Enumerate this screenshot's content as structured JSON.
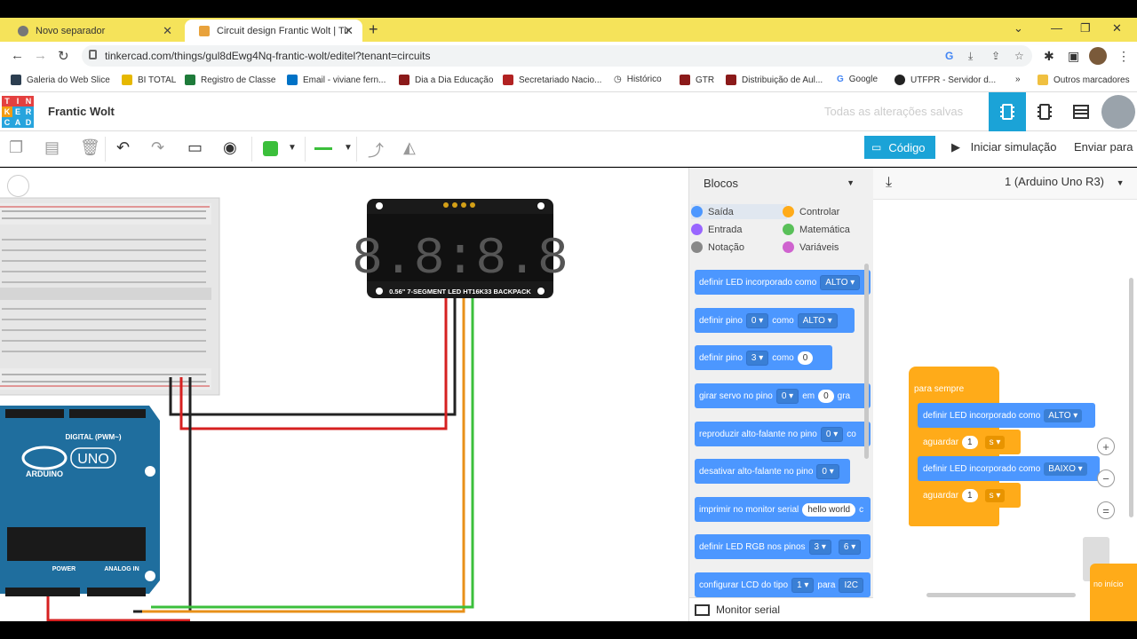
{
  "browser": {
    "tabs": [
      {
        "title": "Novo separador"
      },
      {
        "title": "Circuit design Frantic Wolt | Tinke"
      }
    ],
    "url": "tinkercad.com/things/gul8dEwg4Nq-frantic-wolt/editel?tenant=circuits",
    "bookmarks": [
      "Galeria do Web Slice",
      "BI TOTAL",
      "Registro de Classe",
      "Email - viviane fern...",
      "Dia a Dia Educação",
      "Secretariado Nacio...",
      "Histórico",
      "GTR",
      "Distribuição de Aul...",
      "Google",
      "UTFPR - Servidor d...",
      "»",
      "Outros marcadores"
    ]
  },
  "app": {
    "logo_letters": [
      "T",
      "I",
      "N",
      "K",
      "E",
      "R",
      "C",
      "A",
      "D"
    ],
    "project_name": "Frantic Wolt",
    "saved_status": "Todas as alterações salvas",
    "code_button": "Código",
    "start_sim": "Iniciar simulação",
    "send_to": "Enviar para"
  },
  "canvas": {
    "display_label": "0.56\" 7-SEGMENT LED HT16K33 BACKPACK",
    "display_digits": "8.8:8.8",
    "arduino_digital": "DIGITAL (PWM~)",
    "arduino_brand": "ARDUINO",
    "arduino_uno": "UNO",
    "arduino_power": "POWER",
    "arduino_analog": "ANALOG IN"
  },
  "blocks": {
    "dropdown": "Blocos",
    "categories": [
      {
        "label": "Saída",
        "color": "#4c97ff"
      },
      {
        "label": "Controlar",
        "color": "#ffab19"
      },
      {
        "label": "Entrada",
        "color": "#9966ff"
      },
      {
        "label": "Matemática",
        "color": "#59c059"
      },
      {
        "label": "Notação",
        "color": "#888888"
      },
      {
        "label": "Variáveis",
        "color": "#cf63cf"
      }
    ],
    "palette": [
      {
        "text": "definir LED incorporado como",
        "chip": "ALTO ▾"
      },
      {
        "pre": "definir pino",
        "chip": "0 ▾",
        "mid": "como",
        "chip2": "ALTO ▾"
      },
      {
        "pre": "definir pino",
        "chip": "3 ▾",
        "mid": "como",
        "pill": "0"
      },
      {
        "pre": "girar servo no pino",
        "chip": "0 ▾",
        "mid": "em",
        "pill": "0",
        "post": "gra"
      },
      {
        "pre": "reproduzir alto-falante no pino",
        "chip": "0 ▾",
        "post": "co"
      },
      {
        "pre": "desativar alto-falante no pino",
        "chip": "0 ▾"
      },
      {
        "pre": "imprimir no monitor serial",
        "pill": "hello world",
        "post": "c"
      },
      {
        "pre": "definir LED RGB nos pinos",
        "chip": "3 ▾",
        "chip2": "6 ▾"
      },
      {
        "pre": "configurar LCD do tipo",
        "chip": "1 ▾",
        "mid": "para",
        "post": "I2C"
      }
    ],
    "serial_monitor": "Monitor serial"
  },
  "workspace": {
    "device": "1 (Arduino Uno R3)",
    "forever": "para sempre",
    "stack": [
      {
        "text": "definir LED incorporado como",
        "chip": "ALTO ▾"
      },
      {
        "text": "aguardar",
        "num": "1",
        "unit": "s ▾"
      },
      {
        "text": "definir LED incorporado como",
        "chip": "BAIXO ▾"
      },
      {
        "text": "aguardar",
        "num": "1",
        "unit": "s ▾"
      }
    ],
    "start_block": "no início"
  }
}
